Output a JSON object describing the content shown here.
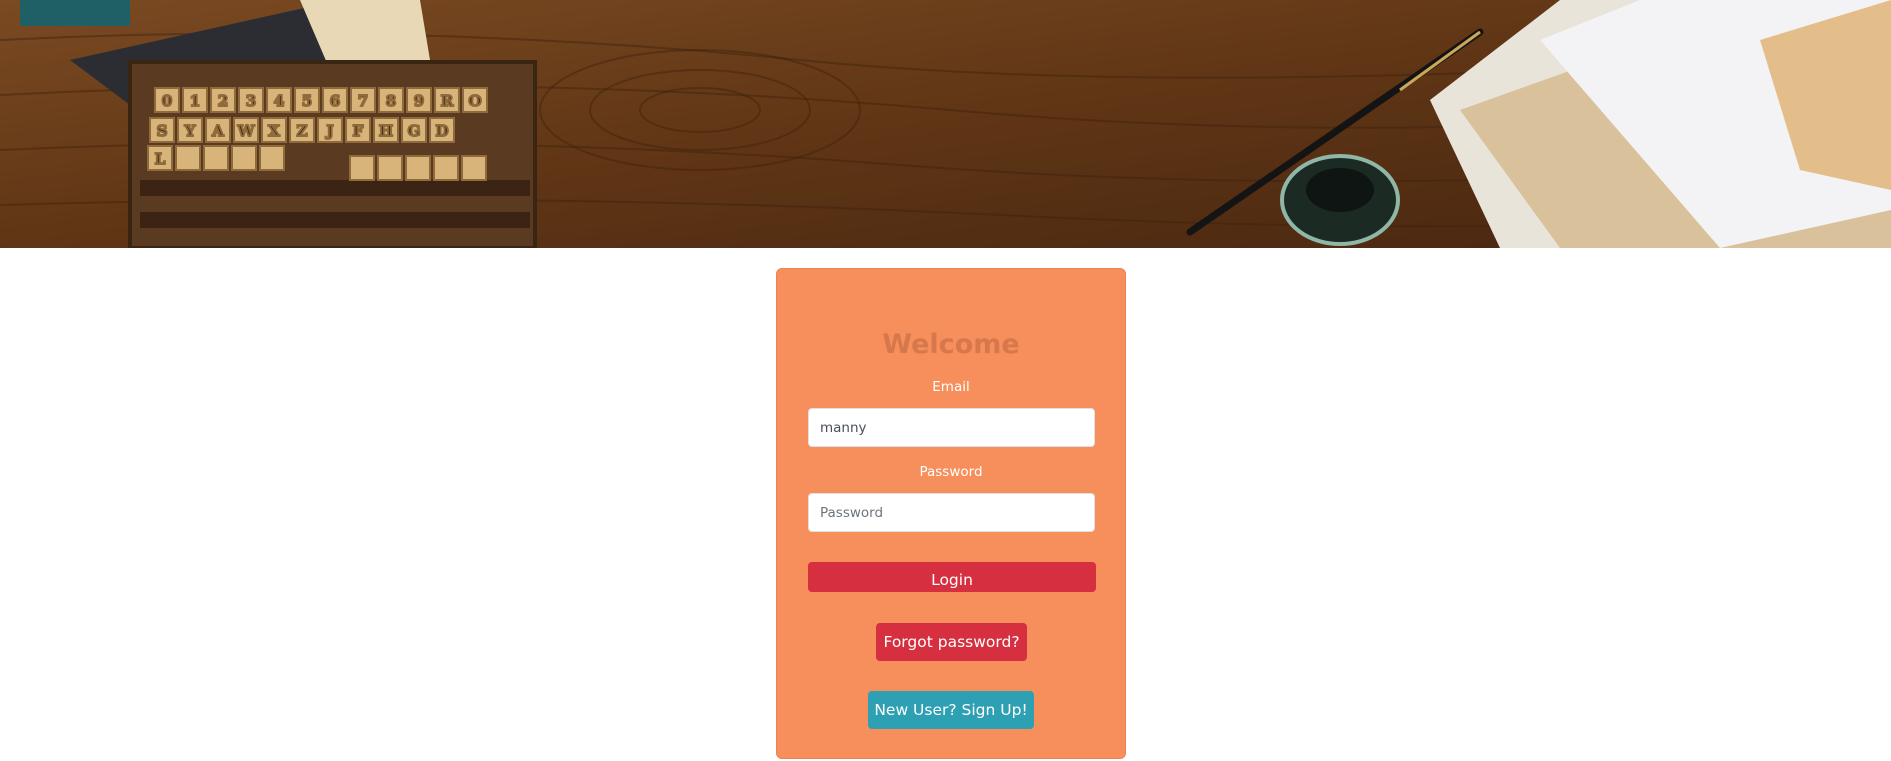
{
  "login": {
    "title": "Welcome",
    "email_label": "Email",
    "email_value": "manny",
    "password_label": "Password",
    "password_placeholder": "Password",
    "login_button": "Login",
    "forgot_button": "Forgot password?",
    "signup_button": "New User? Sign Up!"
  },
  "colors": {
    "card_bg": "#f68f5c",
    "title_text": "#d7774c",
    "danger_button": "#d52f40",
    "info_button": "#2ea0b4"
  },
  "banner": {
    "type_blocks": [
      "0",
      "1",
      "2",
      "3",
      "4",
      "5",
      "6",
      "7",
      "8",
      "9",
      "R",
      "O",
      "S",
      "Y",
      "A",
      "W",
      "X",
      "Z",
      "J",
      "F",
      "H",
      "G",
      "D",
      "L"
    ]
  }
}
